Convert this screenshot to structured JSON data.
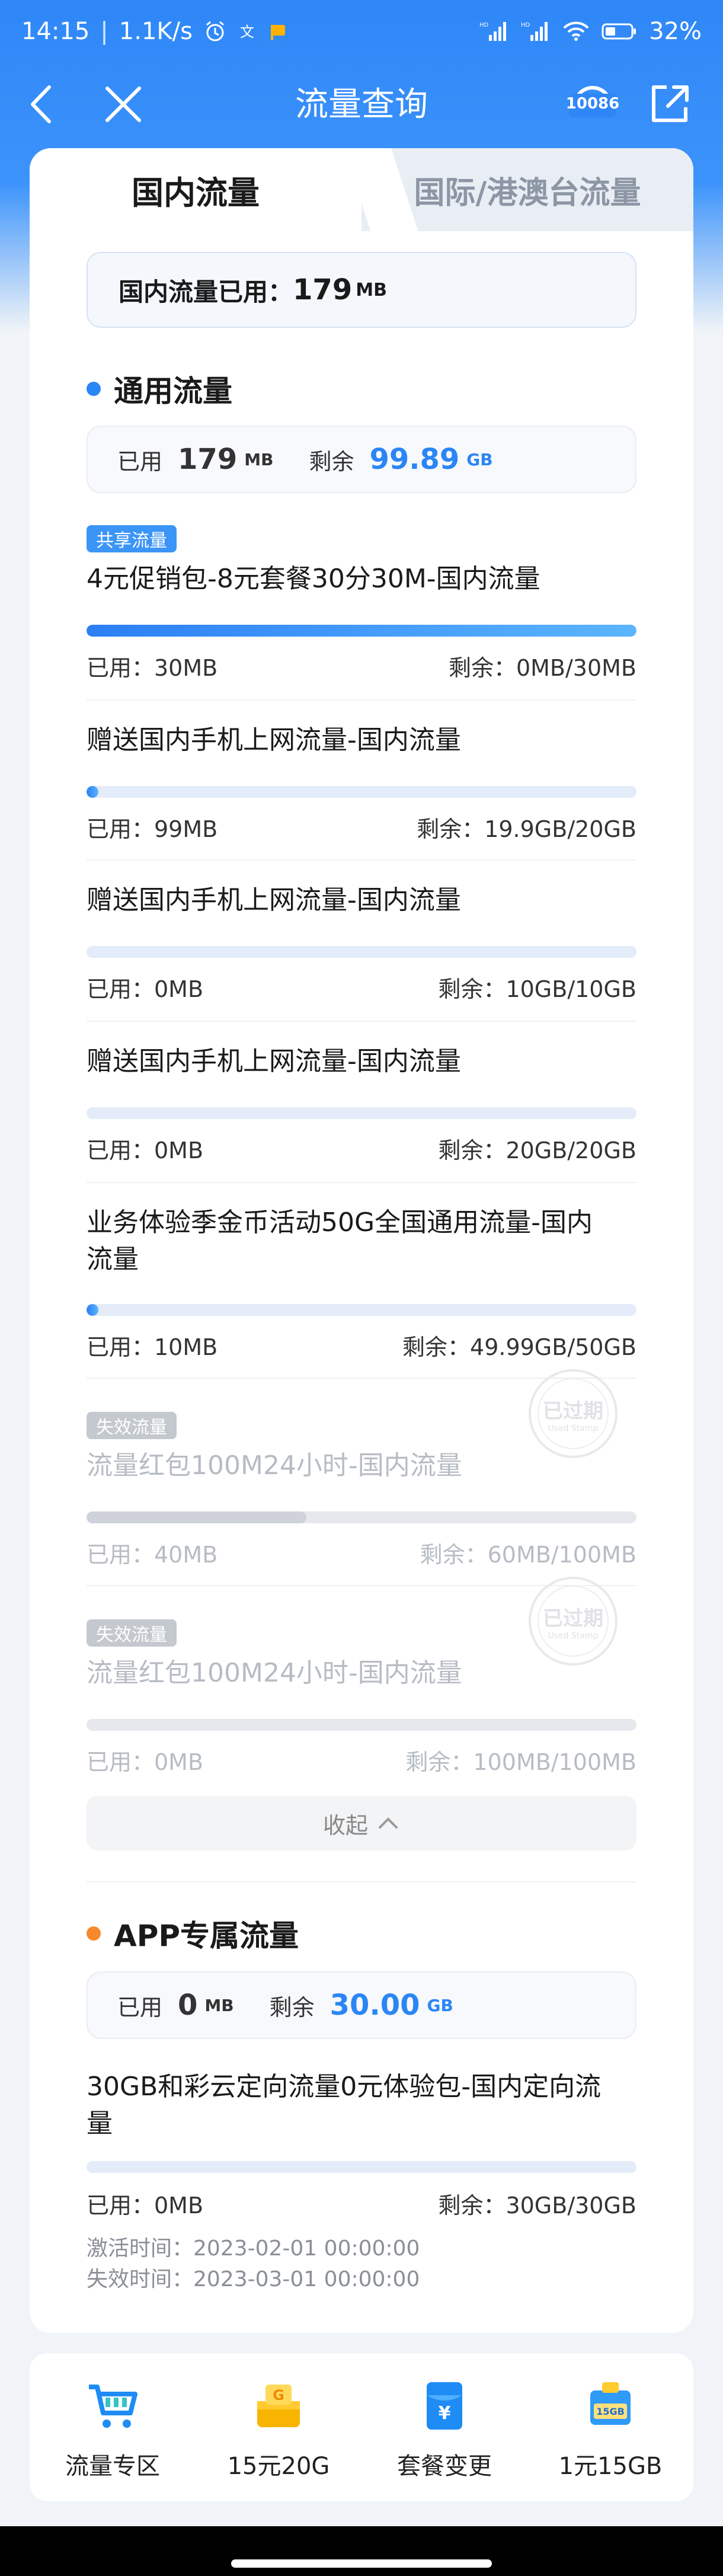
{
  "status_bar": {
    "time": "14:15",
    "speed": "1.1K/s",
    "battery": "32",
    "battery_suffix": "%"
  },
  "nav": {
    "title": "流量查询",
    "service_badge": "10086"
  },
  "tabs": {
    "domestic": "国内流量",
    "international": "国际/港澳台流量"
  },
  "summary": {
    "label": "国内流量已用：",
    "value": "179",
    "unit": "MB"
  },
  "general": {
    "title": "通用流量",
    "used_label": "已用",
    "used_value": "179",
    "used_unit": "MB",
    "remain_label": "剩余",
    "remain_value": "99.89",
    "remain_unit": "GB",
    "items": [
      {
        "badge": "共享流量",
        "title": "4元促销包-8元套餐30分30M-国内流量",
        "progress": 1.0,
        "used": "已用：30MB",
        "remain": "剩余：0MB/30MB"
      },
      {
        "title": "赠送国内手机上网流量-国内流量",
        "progress": 0.005,
        "used": "已用：99MB",
        "remain": "剩余：19.9GB/20GB"
      },
      {
        "title": "赠送国内手机上网流量-国内流量",
        "progress": 0,
        "used": "已用：0MB",
        "remain": "剩余：10GB/10GB"
      },
      {
        "title": "赠送国内手机上网流量-国内流量",
        "progress": 0,
        "used": "已用：0MB",
        "remain": "剩余：20GB/20GB"
      },
      {
        "title_line1": "业务体验季金币活动50G全国通用流量-国内",
        "title_line2": "流量",
        "progress": 0.0002,
        "used": "已用：10MB",
        "remain": "剩余：49.99GB/50GB"
      }
    ],
    "expired_items": [
      {
        "badge": "失效流量",
        "title": "流量红包100M24小时-国内流量",
        "progress": 0.4,
        "used": "已用：40MB",
        "remain": "剩余：60MB/100MB",
        "stamp": "已过期",
        "stamp_sub": "Used Stamp"
      },
      {
        "badge": "失效流量",
        "title": "流量红包100M24小时-国内流量",
        "progress": 0,
        "used": "已用：0MB",
        "remain": "剩余：100MB/100MB",
        "stamp": "已过期",
        "stamp_sub": "Used Stamp"
      }
    ],
    "collapse_label": "收起"
  },
  "app": {
    "title": "APP专属流量",
    "used_label": "已用",
    "used_value": "0",
    "used_unit": "MB",
    "remain_label": "剩余",
    "remain_value": "30.00",
    "remain_unit": "GB",
    "item": {
      "title_line1": "30GB和彩云定向流量0元体验包-国内定向流",
      "title_line2": "量",
      "progress": 0,
      "used": "已用：0MB",
      "remain": "剩余：30GB/30GB",
      "activated": "激活时间：2023-02-01 00:00:00",
      "expires": "失效时间：2023-03-01 00:00:00"
    }
  },
  "actions": [
    {
      "label": "流量专区",
      "icon": "cart-icon"
    },
    {
      "label": "15元20G",
      "icon": "gift-box-icon"
    },
    {
      "label": "套餐变更",
      "icon": "yuan-envelope-icon"
    },
    {
      "label": "1元15GB",
      "icon": "data-card-icon",
      "icon_text": "15GB"
    }
  ],
  "colors": {
    "primary": "#2b86f5",
    "general_dot": "#2b86f5",
    "app_dot": "#f5892b",
    "badge_shared": "#3b95f7",
    "badge_expired": "#c4c8cf"
  }
}
